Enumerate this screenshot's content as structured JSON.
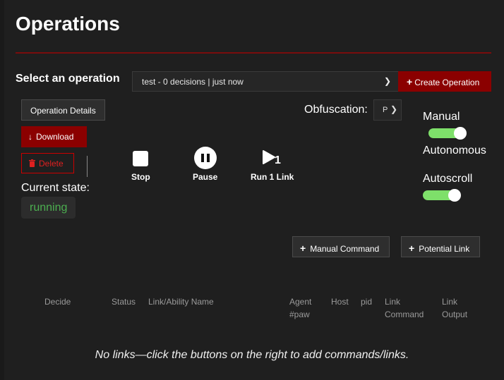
{
  "page": {
    "title": "Operations"
  },
  "operation_select": {
    "label": "Select an operation",
    "selected": "test - 0 decisions | just now",
    "chevron_icon": "chevron-down-icon"
  },
  "create_button": {
    "icon": "plus-icon",
    "label": "Create Operation"
  },
  "buttons": {
    "details": "Operation Details",
    "download": "Download",
    "delete": "Delete"
  },
  "state": {
    "label": "Current state:",
    "value": "running"
  },
  "controls": {
    "stop": "Stop",
    "pause": "Pause",
    "run": "Run 1 Link",
    "run_badge": "1"
  },
  "obfuscation": {
    "label": "Obfuscation:",
    "value": "P"
  },
  "modes": {
    "manual": "Manual",
    "autonomous": "Autonomous",
    "autoscroll": "Autoscroll",
    "mode_toggle_on": true,
    "autoscroll_on": true
  },
  "actions": {
    "manual_command": "Manual Command",
    "potential_link": "Potential Link"
  },
  "table": {
    "headers": {
      "decide": "Decide",
      "status": "Status",
      "name": "Link/Ability Name",
      "agent": "Agent",
      "paw": "#paw",
      "host": "Host",
      "pid": "pid",
      "link1": "Link",
      "command": "Command",
      "link2": "Link",
      "output": "Output"
    },
    "empty": "No links—click the buttons on the right to add commands/links."
  },
  "colors": {
    "accent": "#8b0000",
    "toggle": "#7ee06a",
    "state": "#4caf50",
    "delete": "#e02020"
  }
}
